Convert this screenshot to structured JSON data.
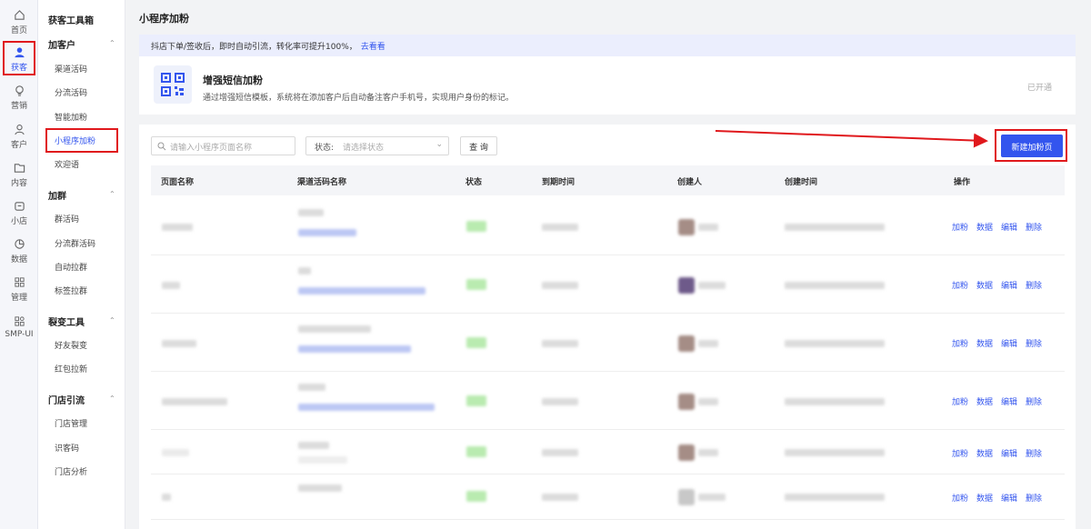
{
  "rail": [
    {
      "label": "首页",
      "icon": "home-icon"
    },
    {
      "label": "获客",
      "icon": "user-acquire-icon",
      "active": true
    },
    {
      "label": "营销",
      "icon": "bulb-icon"
    },
    {
      "label": "客户",
      "icon": "customer-icon"
    },
    {
      "label": "内容",
      "icon": "folder-icon"
    },
    {
      "label": "小店",
      "icon": "shop-icon"
    },
    {
      "label": "数据",
      "icon": "pie-chart-icon"
    },
    {
      "label": "管理",
      "icon": "grid-icon"
    },
    {
      "label": "SMP-UI",
      "icon": "apps-icon"
    }
  ],
  "submenu": {
    "title": "获客工具箱",
    "groups": [
      {
        "label": "加客户",
        "items": [
          "渠道活码",
          "分流活码",
          "智能加粉",
          "小程序加粉",
          "欢迎语"
        ]
      },
      {
        "label": "加群",
        "items": [
          "群活码",
          "分流群活码",
          "自动拉群",
          "标签拉群"
        ]
      },
      {
        "label": "裂变工具",
        "items": [
          "好友裂变",
          "红包拉新"
        ]
      },
      {
        "label": "门店引流",
        "items": [
          "门店管理",
          "识客码",
          "门店分析"
        ]
      }
    ],
    "active_item": "小程序加粉"
  },
  "page_title": "小程序加粉",
  "banner": {
    "text": "抖店下单/签收后，即时自动引流，转化率可提升100%，",
    "link": "去看看"
  },
  "feature_card": {
    "title": "增强短信加粉",
    "desc": "通过增强短信模板，系统将在添加客户后自动备注客户手机号，实现用户身份的标记。",
    "status": "已开通"
  },
  "toolbar": {
    "search_placeholder": "请输入小程序页面名称",
    "status_label": "状态:",
    "status_placeholder": "请选择状态",
    "query_label": "查 询",
    "new_button": "新建加粉页"
  },
  "table": {
    "columns": [
      "页面名称",
      "渠道活码名称",
      "状态",
      "到期时间",
      "创建人",
      "创建时间",
      "操作"
    ],
    "actions": [
      "加粉",
      "数据",
      "编辑",
      "删除"
    ],
    "row_count": 6
  },
  "colors": {
    "accent": "#3355ee",
    "highlight": "#e0181c"
  }
}
